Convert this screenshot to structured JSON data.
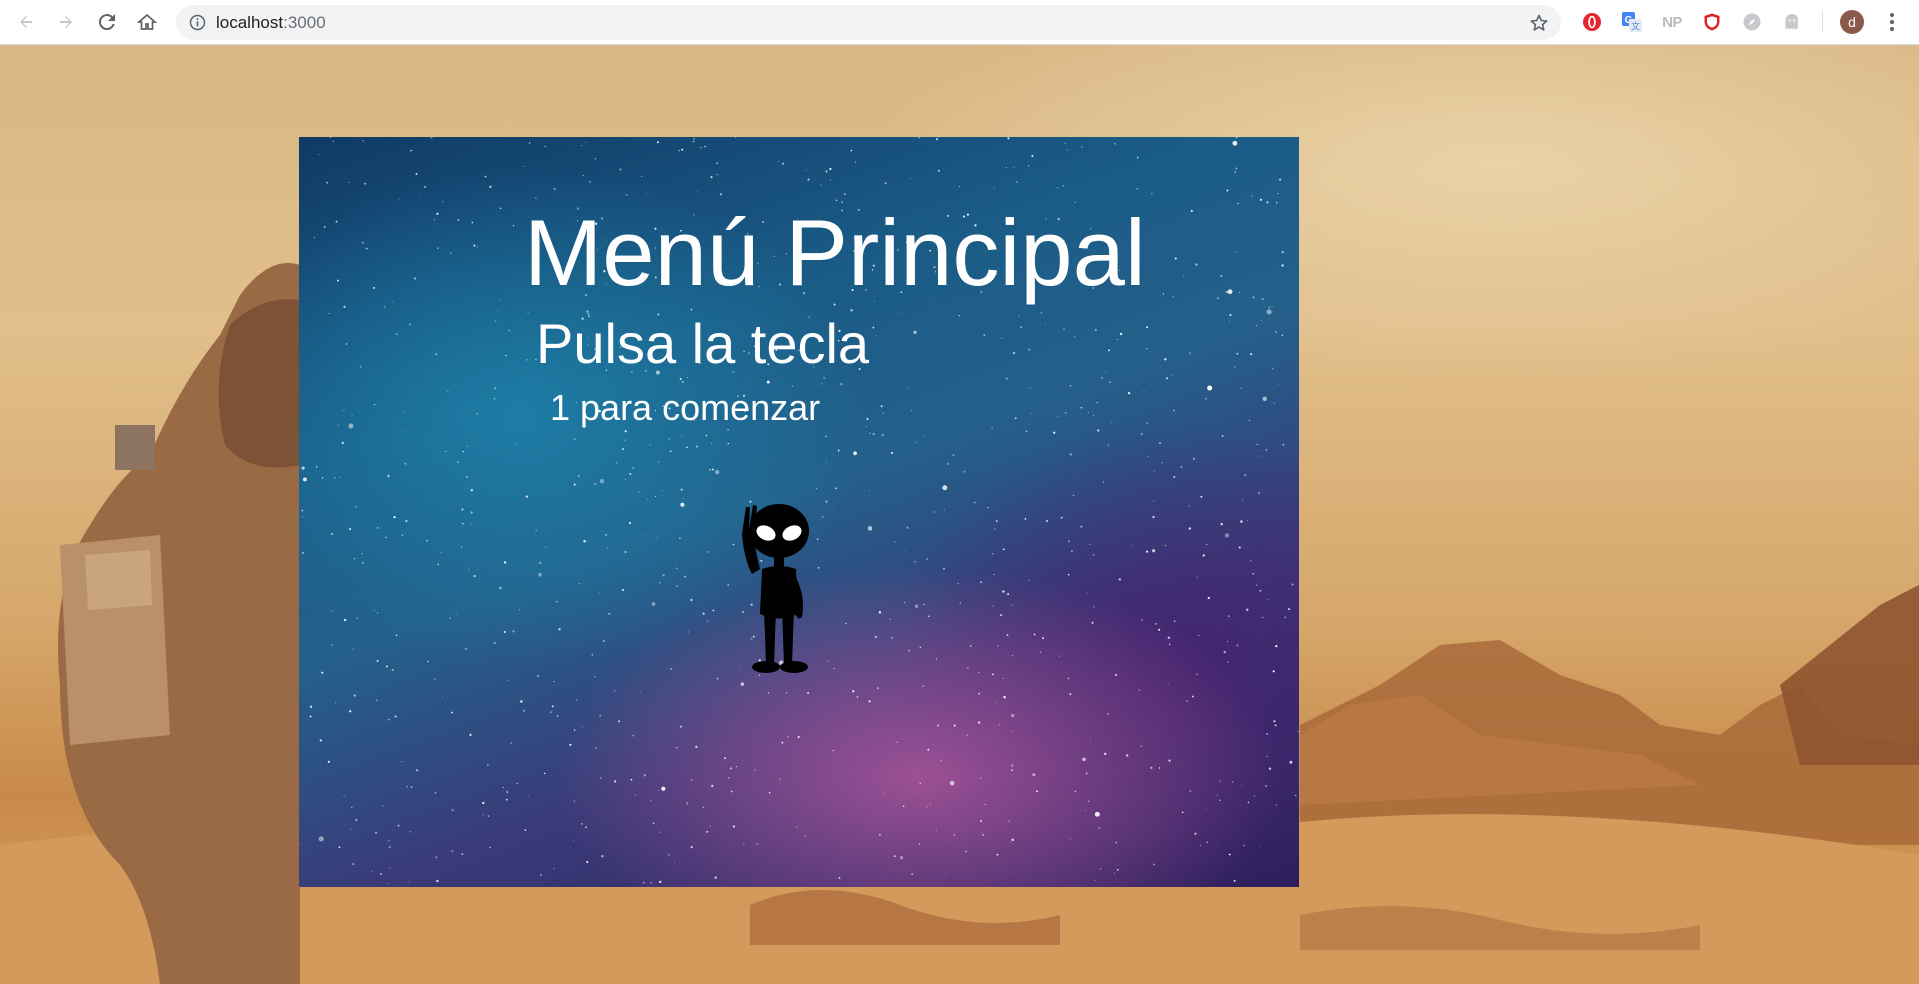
{
  "browser": {
    "url_host": "localhost",
    "url_port": ":3000",
    "avatar_letter": "d",
    "extensions": [
      "opera-icon",
      "translate-icon",
      "np-icon",
      "shield-icon",
      "compass-icon",
      "ghost-icon"
    ],
    "np_label": "NP"
  },
  "game": {
    "title": "Menú Principal",
    "subtitle": "Pulsa la tecla",
    "instruction": "1 para comenzar",
    "sprite": "alien-icon"
  },
  "colors": {
    "text": "#ffffff",
    "sky_deep": "#103a66",
    "nebula_pink": "#be5aa0",
    "desert": "#d5a66a"
  }
}
